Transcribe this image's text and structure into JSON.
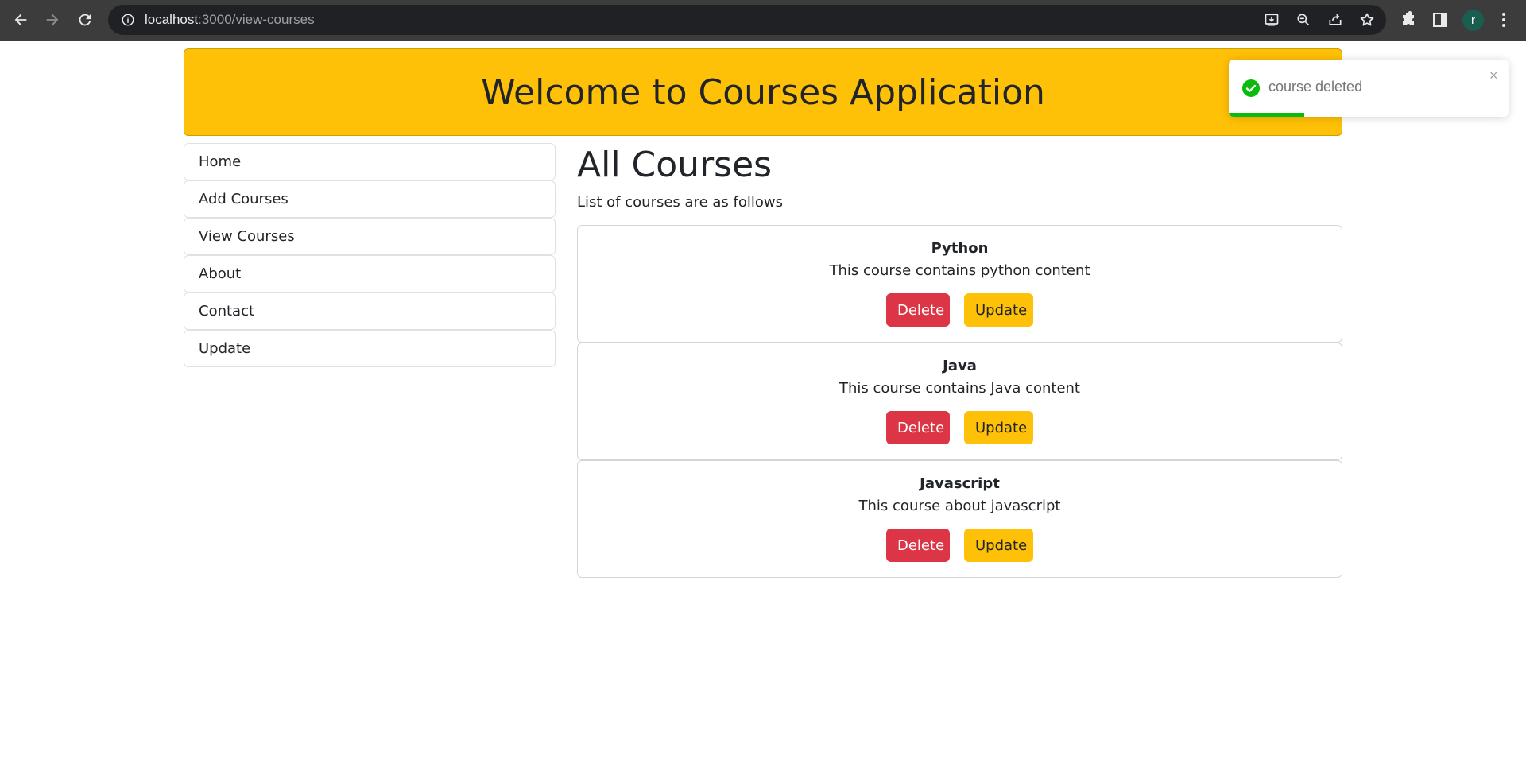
{
  "browser": {
    "url_host": "localhost",
    "url_path": ":3000/view-courses",
    "profile_initial": "r"
  },
  "icons": {
    "back": "back-arrow-icon",
    "forward": "forward-arrow-icon",
    "reload": "reload-icon",
    "info": "info-icon",
    "install": "install-app-icon",
    "zoom": "zoom-out-icon",
    "share": "share-icon",
    "bookmark": "star-icon",
    "extensions": "puzzle-icon",
    "side_panel": "side-panel-icon",
    "menu": "kebab-menu-icon"
  },
  "colors": {
    "warning": "#ffc107",
    "danger": "#dc3545",
    "toast_success": "#07bc0c"
  },
  "header": {
    "title": "Welcome to Courses Application"
  },
  "sidebar": {
    "items": [
      {
        "label": "Home"
      },
      {
        "label": "Add Courses"
      },
      {
        "label": "View Courses"
      },
      {
        "label": "About"
      },
      {
        "label": "Contact"
      },
      {
        "label": "Update"
      }
    ]
  },
  "main": {
    "title": "All Courses",
    "subtitle": "List of courses are as follows",
    "courses": [
      {
        "title": "Python",
        "description": "This course contains python content",
        "delete_label": "Delete",
        "update_label": "Update"
      },
      {
        "title": "Java",
        "description": "This course contains Java content",
        "delete_label": "Delete",
        "update_label": "Update"
      },
      {
        "title": "Javascript",
        "description": "This course about javascript",
        "delete_label": "Delete",
        "update_label": "Update"
      }
    ]
  },
  "toast": {
    "message": "course deleted",
    "close": "×",
    "progress_fraction": 0.27
  }
}
